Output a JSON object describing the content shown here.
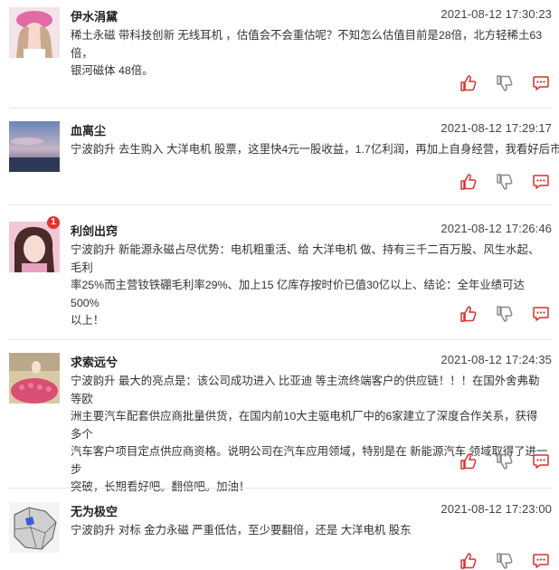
{
  "posts": [
    {
      "username": "伊水涓黛",
      "time": "2021-08-12 17:30:23",
      "segments": [
        "稀土永磁 带科技创新 无线耳机 ，估值会不会重估呢？不知怎么估值目前是28倍，北方轻稀土63倍，",
        "银河磁体 48倍。"
      ],
      "badge": ""
    },
    {
      "username": "血离尘",
      "time": "2021-08-12 17:29:17",
      "segments": [
        "宁波韵升 去生购入 大洋电机 股票，这里快4元一股收益，1.7亿利润，再加上自身经营，我看好后市"
      ],
      "badge": ""
    },
    {
      "username": "利剑出窍",
      "time": "2021-08-12 17:26:46",
      "segments": [
        "宁波韵升 新能源永磁占尽优势：电机粗重活、给 大洋电机 做、持有三千二百万股、风生水起、毛利",
        "率25%而主营钕铁硼毛利率29%、加上15 亿库存按时价已值30亿以上、结论：全年业绩可达500%",
        "以上！"
      ],
      "badge": "1"
    },
    {
      "username": "求索远兮",
      "time": "2021-08-12 17:24:35",
      "segments": [
        "宁波韵升 最大的亮点是：该公司成功进入 比亚迪 等主流终端客户的供应链！！！在国外舍弗勒等欧",
        "洲主要汽车配套供应商批量供货，在国内前10大主驱电机厂中的6家建立了深度合作关系，获得多个",
        "汽车客户项目定点供应商资格。说明公司在汽车应用领域，特别是在 新能源汽车 领域取得了进一步",
        "突破，长期看好吧。翻倍吧。加油！"
      ],
      "badge": ""
    },
    {
      "username": "无为极空",
      "time": "2021-08-12 17:23:00",
      "segments": [
        "宁波韵升 对标 金力永磁 严重低估，至少要翻倍，还是 大洋电机 股东"
      ],
      "badge": ""
    }
  ],
  "colors": {
    "accent": "#e8312f",
    "icon": "#d9302c",
    "divider": "#e6e6e6"
  },
  "icons": [
    "thumbs-up-icon",
    "thumbs-down-icon",
    "comment-icon"
  ]
}
